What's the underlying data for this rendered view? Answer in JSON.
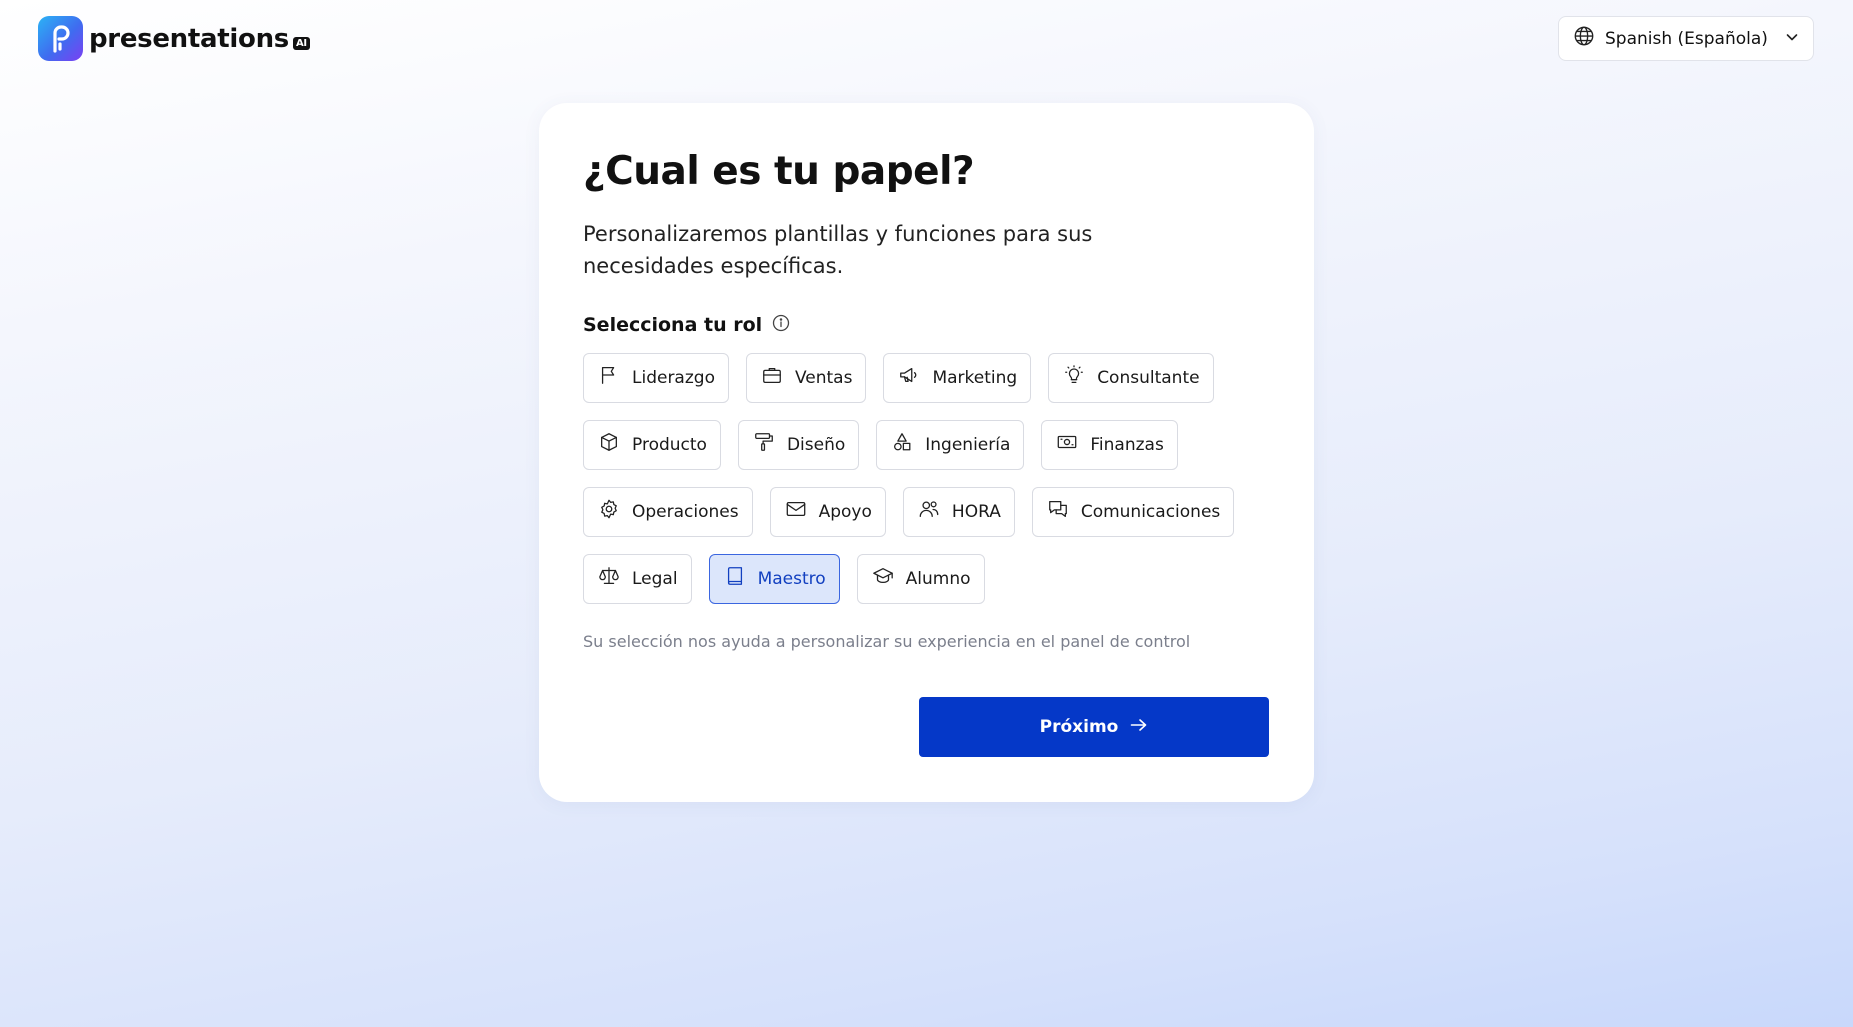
{
  "brand": {
    "name": "presentations",
    "suffix": "AI"
  },
  "language_selector": {
    "label": "Spanish (Española)"
  },
  "card": {
    "title": "¿Cual es tu papel?",
    "subtitle": "Personalizaremos plantillas y funciones para sus necesidades específicas.",
    "section_label": "Selecciona tu rol",
    "helper": "Su selección nos ayuda a personalizar su experiencia en el panel de control",
    "next_label": "Próximo"
  },
  "roles": [
    [
      {
        "label": "Liderazgo",
        "icon": "flag-icon",
        "selected": false
      },
      {
        "label": "Ventas",
        "icon": "briefcase-icon",
        "selected": false
      },
      {
        "label": "Marketing",
        "icon": "megaphone-icon",
        "selected": false
      },
      {
        "label": "Consultante",
        "icon": "lightbulb-icon",
        "selected": false
      }
    ],
    [
      {
        "label": "Producto",
        "icon": "box-icon",
        "selected": false
      },
      {
        "label": "Diseño",
        "icon": "paint-roller-icon",
        "selected": false
      },
      {
        "label": "Ingeniería",
        "icon": "shapes-icon",
        "selected": false
      },
      {
        "label": "Finanzas",
        "icon": "banknote-icon",
        "selected": false
      }
    ],
    [
      {
        "label": "Operaciones",
        "icon": "gear-icon",
        "selected": false
      },
      {
        "label": "Apoyo",
        "icon": "mail-icon",
        "selected": false
      },
      {
        "label": "HORA",
        "icon": "users-icon",
        "selected": false
      },
      {
        "label": "Comunicaciones",
        "icon": "chat-icon",
        "selected": false
      }
    ],
    [
      {
        "label": "Legal",
        "icon": "scale-icon",
        "selected": false
      },
      {
        "label": "Maestro",
        "icon": "book-icon",
        "selected": true
      },
      {
        "label": "Alumno",
        "icon": "graduation-cap-icon",
        "selected": false
      }
    ]
  ],
  "colors": {
    "primary": "#0538c8",
    "selected_bg": "#dce6fb",
    "selected_border": "#3b66e0"
  }
}
